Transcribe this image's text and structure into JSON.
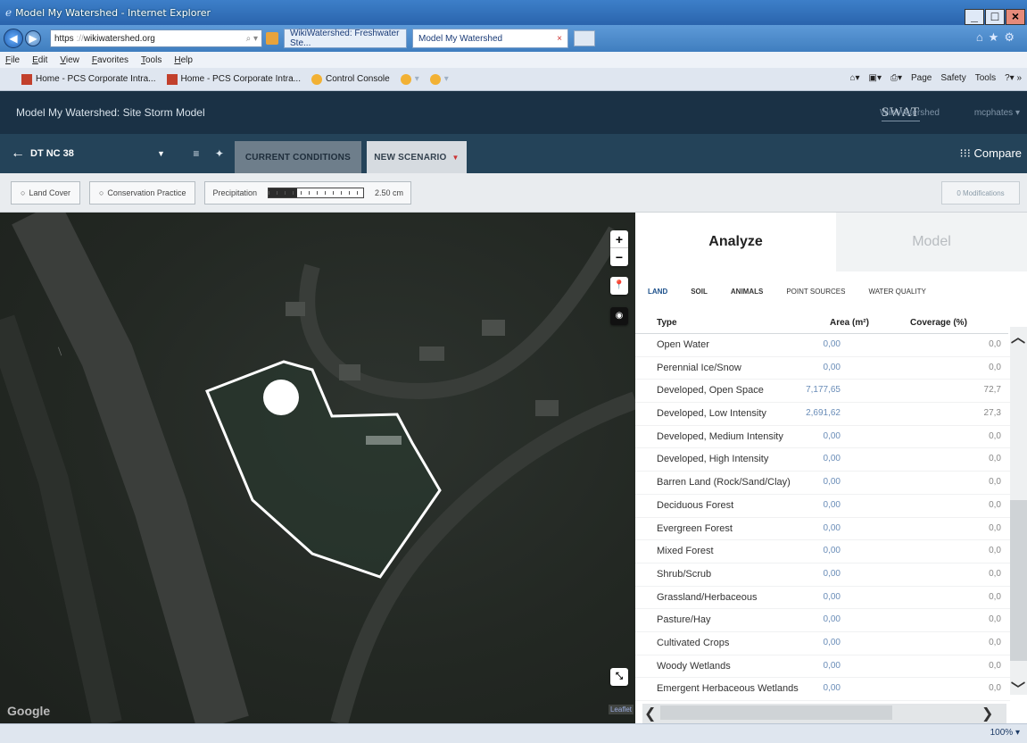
{
  "window": {
    "title": "Model My Watershed - Internet Explorer",
    "url_prefix": "https",
    "url_host": "wikiwatershed.org",
    "tabs": [
      "WikiWatershed: Freshwater Ste...",
      "Model My Watershed"
    ],
    "menu": [
      "File",
      "Edit",
      "View",
      "Favorites",
      "Tools",
      "Help"
    ],
    "favorites": [
      "Home - PCS Corporate Intra...",
      "Home - PCS Corporate Intra...",
      "Control Console"
    ],
    "commands": [
      "Page",
      "Safety",
      "Tools"
    ],
    "zoom": "100%"
  },
  "app": {
    "title": "Model My Watershed: Site Storm Model",
    "brand": "SWAT",
    "site_link": "WikiWatershed",
    "user": "mcphates"
  },
  "project": {
    "name": "DT NC 38",
    "tab_current": "CURRENT CONDITIONS",
    "tab_new": "NEW SCENARIO",
    "compare": "Compare"
  },
  "toolbar": {
    "land_cover": "Land Cover",
    "conservation": "Conservation Practice",
    "precip_label": "Precipitation",
    "precip_value": "2.50 cm",
    "precip_fraction": 0.3,
    "modifications": "0 Modifications"
  },
  "map": {
    "google": "Google",
    "leaflet": "Leaflet",
    "zoom_in": "+",
    "zoom_out": "−"
  },
  "panel": {
    "tab_analyze": "Analyze",
    "tab_model": "Model",
    "subtabs": [
      "LAND",
      "SOIL",
      "ANIMALS",
      "POINT SOURCES",
      "WATER QUALITY"
    ],
    "col_type": "Type",
    "col_area": "Area (m²)",
    "col_cov": "Coverage (%)",
    "rows": [
      {
        "type": "Open Water",
        "area": "0,00",
        "cov": "0,0"
      },
      {
        "type": "Perennial Ice/Snow",
        "area": "0,00",
        "cov": "0,0"
      },
      {
        "type": "Developed, Open Space",
        "area": "7,177,65",
        "cov": "72,7"
      },
      {
        "type": "Developed, Low Intensity",
        "area": "2,691,62",
        "cov": "27,3"
      },
      {
        "type": "Developed, Medium Intensity",
        "area": "0,00",
        "cov": "0,0"
      },
      {
        "type": "Developed, High Intensity",
        "area": "0,00",
        "cov": "0,0"
      },
      {
        "type": "Barren Land (Rock/Sand/Clay)",
        "area": "0,00",
        "cov": "0,0"
      },
      {
        "type": "Deciduous Forest",
        "area": "0,00",
        "cov": "0,0"
      },
      {
        "type": "Evergreen Forest",
        "area": "0,00",
        "cov": "0,0"
      },
      {
        "type": "Mixed Forest",
        "area": "0,00",
        "cov": "0,0"
      },
      {
        "type": "Shrub/Scrub",
        "area": "0,00",
        "cov": "0,0"
      },
      {
        "type": "Grassland/Herbaceous",
        "area": "0,00",
        "cov": "0,0"
      },
      {
        "type": "Pasture/Hay",
        "area": "0,00",
        "cov": "0,0"
      },
      {
        "type": "Cultivated Crops",
        "area": "0,00",
        "cov": "0,0"
      },
      {
        "type": "Woody Wetlands",
        "area": "0,00",
        "cov": "0,0"
      },
      {
        "type": "Emergent Herbaceous Wetlands",
        "area": "0,00",
        "cov": "0,0"
      }
    ]
  }
}
